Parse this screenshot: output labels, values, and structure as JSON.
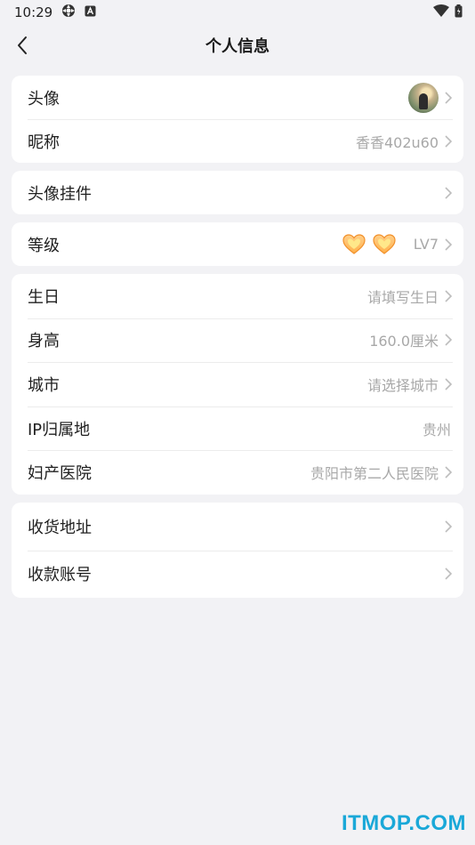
{
  "status_bar": {
    "time": "10:29"
  },
  "header": {
    "title": "个人信息"
  },
  "group1": {
    "avatar_label": "头像",
    "nickname_label": "昵称",
    "nickname_value": "香香402u60"
  },
  "group2": {
    "pendant_label": "头像挂件"
  },
  "group3": {
    "level_label": "等级",
    "level_value": "LV7"
  },
  "group4": {
    "birthday_label": "生日",
    "birthday_value": "请填写生日",
    "height_label": "身高",
    "height_value": "160.0厘米",
    "city_label": "城市",
    "city_value": "请选择城市",
    "ip_label": "IP归属地",
    "ip_value": "贵州",
    "hospital_label": "妇产医院",
    "hospital_value": "贵阳市第二人民医院"
  },
  "group5": {
    "address_label": "收货地址",
    "account_label": "收款账号"
  },
  "watermark": "ITMOP.COM",
  "colors": {
    "background": "#f2f2f5",
    "card": "#ffffff",
    "secondary_text": "#a8a8a8",
    "watermark": "#1aa8d8"
  }
}
